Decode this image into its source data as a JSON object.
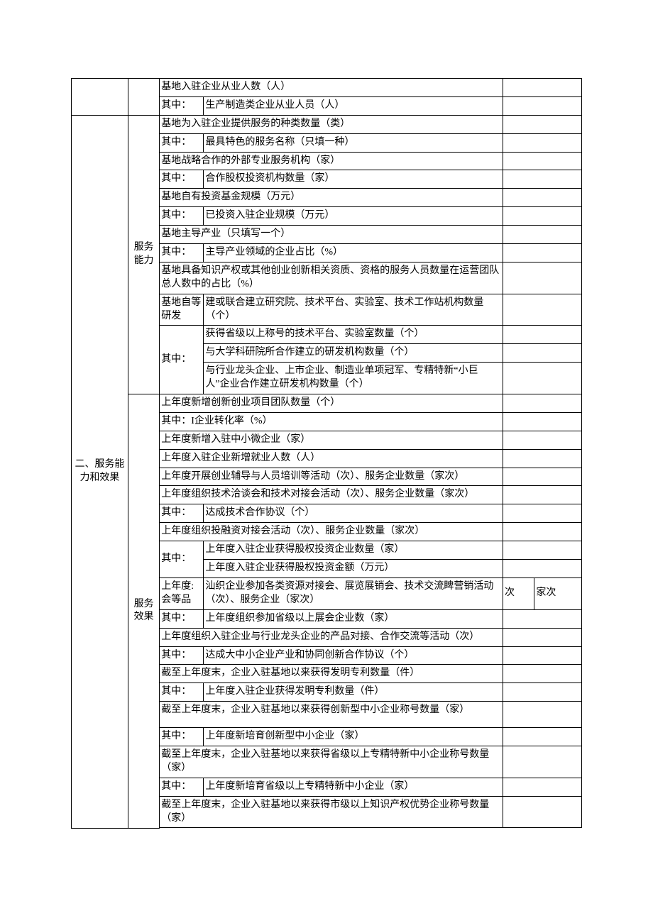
{
  "top": {
    "row1": "基地入驻企业从业人数（人）",
    "row2_label": "其中：",
    "row2_value": "生产制造类企业从业人员（人）"
  },
  "section2": {
    "title": "二、服务能力和效果",
    "cap": {
      "label": "服务能力",
      "r1": "基地为入驻企业提供服务的种类数量（类）",
      "r2l": "其中：",
      "r2": "最具特色的服务名称（只填一种）",
      "r3": "基地战略合作的外部专业服务机构（家）",
      "r4l": "其中：",
      "r4": "合作股权投资机构数量（家）",
      "r5": "基地自有投资基金规模（万元）",
      "r6l": "其中：",
      "r6": "已投资入驻企业规模（万元）",
      "r7": "基地主导产业（只填写一个）",
      "r8l": "其中：",
      "r8": "主导产业领域的企业占比（%）",
      "r9": "基地具备知识产权或其他创业创新相关资质、资格的服务人员数量在运营团队总人数中的占比（%）",
      "r10l": "基地自等研发",
      "r10": "建或联合建立研究院、技术平台、实验室、技术工作站机构数量（个）",
      "r11l": "其中：",
      "r11a": "获得省级以上称号的技术平台、实验室数量（个）",
      "r11b": "与大学科研院所合作建立的研发机构数量（个）",
      "r11c": "与行业龙头企业、上市企业、制造业单项冠军、专精特新“小巨人”企业合作建立研发机构数量（个）"
    },
    "eff": {
      "label": "服务效果",
      "r1": "上年度新增创新创业项目团队数量（个）",
      "r2": "其中：I企业转化率（%）",
      "r3": "上年度新增入驻中小微企业（家）",
      "r4": "上年度入驻企业新增就业人数（人）",
      "r5": "上年度开展创业辅导与人员培训等活动（次）、服务企业数量（家次）",
      "r6": "上年度组织技术洽谈会和技术对接会活动（次）、服务企业数量（家次）",
      "r7l": "其中：",
      "r7": "达成技术合作协议（个）",
      "r8": "上年度组织投融资对接会活动（次）、服务企业数量（家次）",
      "r9l": "其中：",
      "r9a": "上年度入驻企业获得股权投资企业数量（家）",
      "r9b": "上年度入驻企业获得股权投资金额（万元）",
      "r10l": "上年度:会等品",
      "r10": "汕织企业参加各类资源对接会、展览展销会、技术交流睥营销活动（次）、服务企业（家次）",
      "r10_v1": "次",
      "r10_v2": "家次",
      "r11l": "其中：",
      "r11": "上年度组织参加省级以上展会企业数（家）",
      "r12": "上年度组织入驻企业与行业龙头企业的产品对接、合作交流等活动（次）",
      "r13l": "其中：",
      "r13": "达成大中小企业产业和协同创新合作协议（个）",
      "r14": "截至上年度末，企业入驻基地以来获得发明专利数量（件）",
      "r15l": "其中：",
      "r15": "上年度入驻企业获得发明专利数量（件）",
      "r16": "截至上年度末，企业入驻基地以来获得创新型中小企业称号数量（家）",
      "r17l": "其中：",
      "r17": "上年度新培育创新型中小企业（家）",
      "r18": "截至上年度末，企业入驻基地以来获得省级以上专精特新中小企业称号数量（家）",
      "r19l": "其中：",
      "r19": "上年度新培育省级以上专精特新中小企业（家）",
      "r20": "截至上年度末，企业入驻基地以来获得市级以上知识产权优势企业称号数量（家）"
    }
  }
}
